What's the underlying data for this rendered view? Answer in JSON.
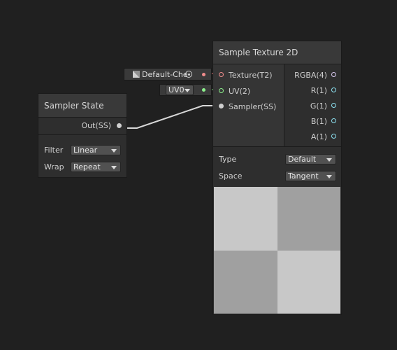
{
  "sampler_node": {
    "title": "Sampler State",
    "output_label": "Out(SS)",
    "filter_label": "Filter",
    "filter_value": "Linear",
    "wrap_label": "Wrap",
    "wrap_value": "Repeat"
  },
  "texture_input": {
    "value": "Default-Che"
  },
  "uv_input": {
    "value": "UV0"
  },
  "sample_node": {
    "title": "Sample Texture 2D",
    "inputs": [
      "Texture(T2)",
      "UV(2)",
      "Sampler(SS)"
    ],
    "outputs": [
      "RGBA(4)",
      "R(1)",
      "G(1)",
      "B(1)",
      "A(1)"
    ],
    "type_label": "Type",
    "type_value": "Default",
    "space_label": "Space",
    "space_value": "Tangent"
  },
  "colors": {
    "background": "#202020",
    "node_body": "#2e2e2e",
    "node_header": "#393939",
    "texture_port": "#f08c8c",
    "uv_port": "#8cf08c",
    "vector_port": "#8ce0f0",
    "rgba_port": "#d8c8f0"
  },
  "preview": {
    "pattern": "checkerboard 2x2",
    "light": "#c8c8c8",
    "dark": "#a0a0a0"
  }
}
